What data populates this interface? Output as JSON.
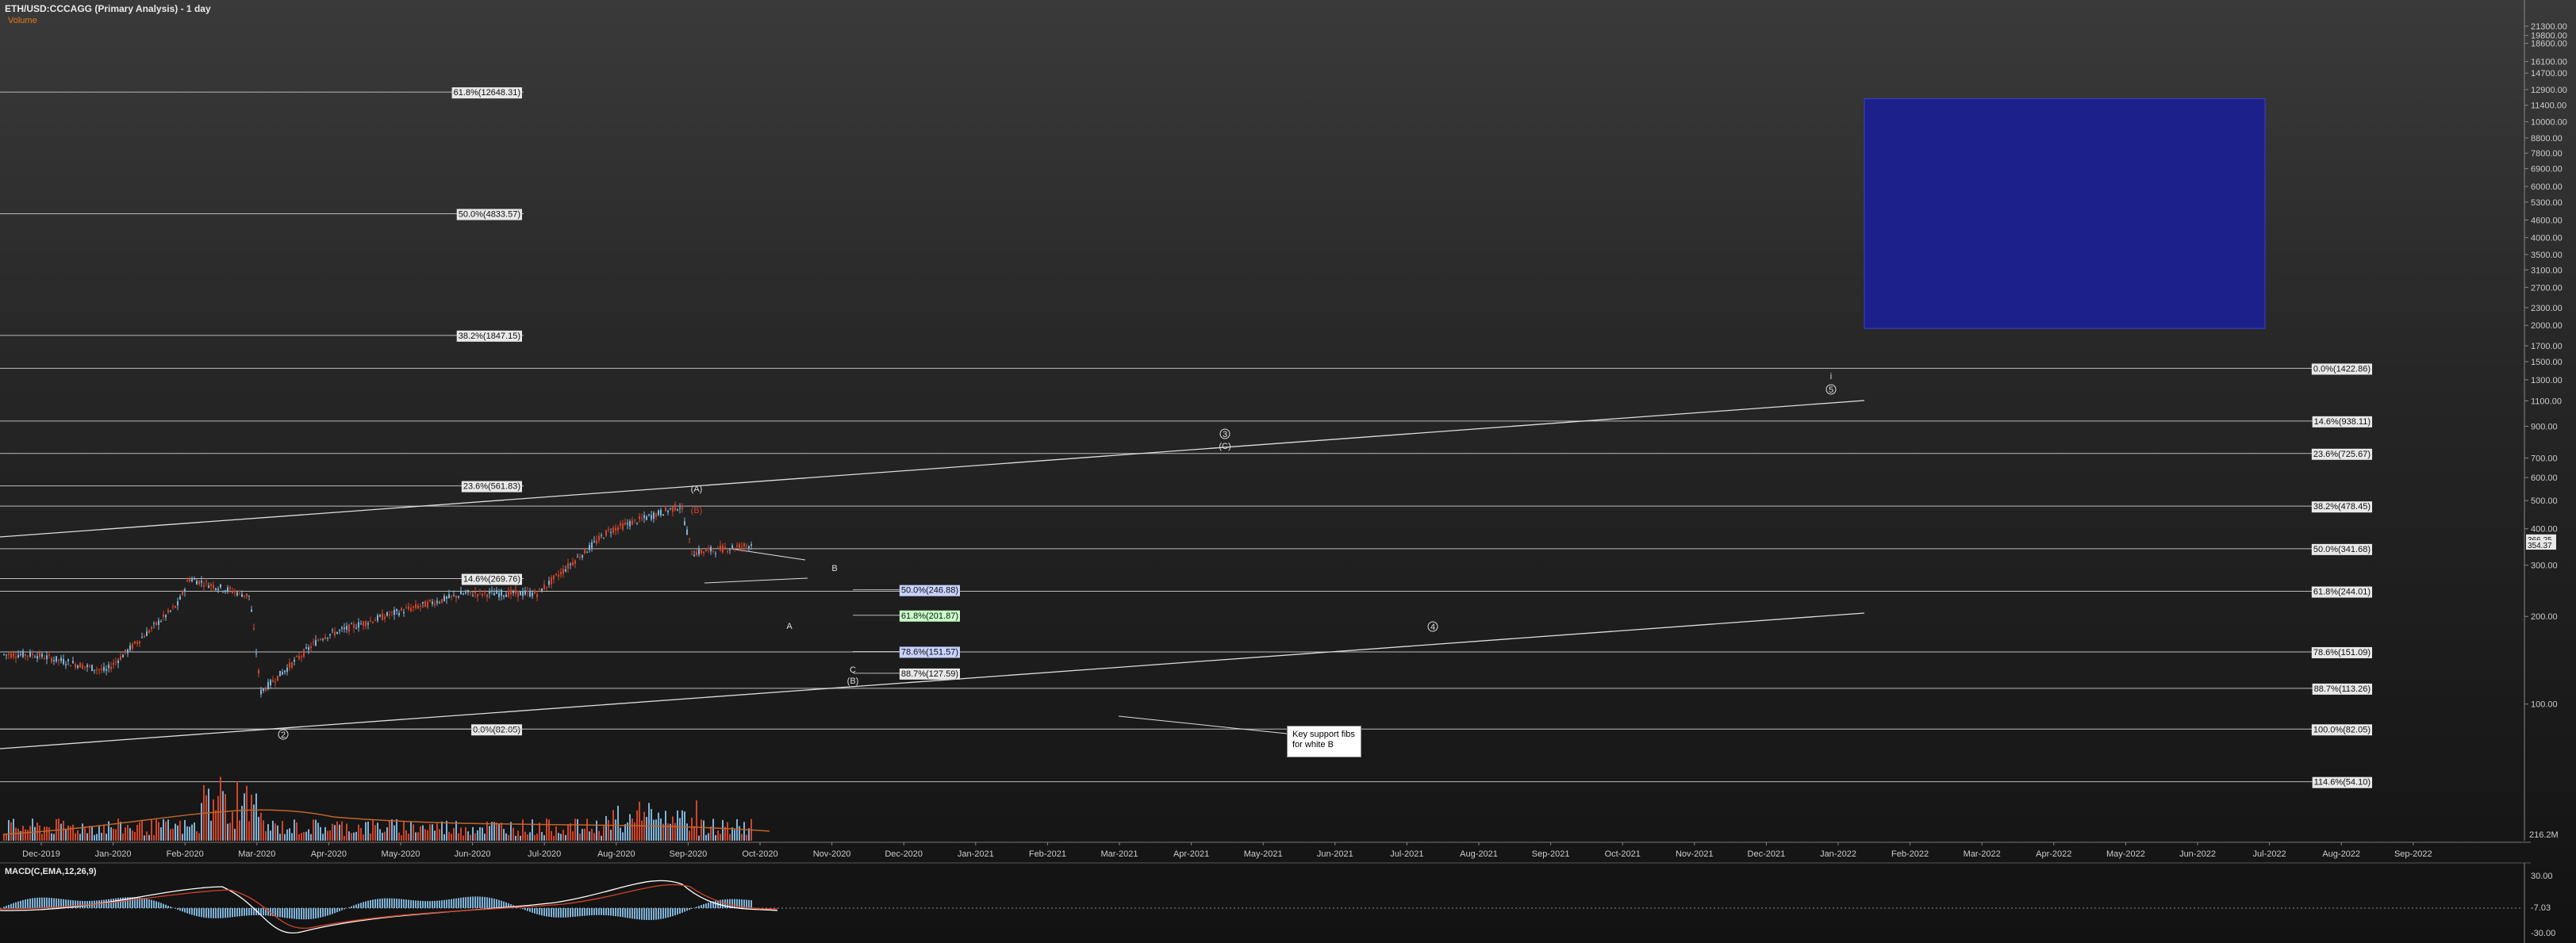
{
  "header": {
    "title": "ETH/USD:CCCAGG (Primary Analysis) - 1 day",
    "volume_label": "Volume"
  },
  "macd": {
    "label": "MACD(C,EMA,12,26,9)",
    "axis": [
      "30.00",
      "-7.03",
      "-30.00"
    ]
  },
  "volume_axis": {
    "label": "216.2M"
  },
  "annotation": {
    "lines": [
      "Key support fibs",
      "for white B"
    ]
  },
  "colors": {
    "up": "#7fb2d6",
    "down": "#d0442a",
    "line": "#d9d9d9",
    "target_box": "#1c208a",
    "volume_ma": "#c0652a"
  },
  "chart_data": {
    "type": "candlestick",
    "title": "ETH/USD:CCCAGG (Primary Analysis) - 1 day",
    "y_scale": "log",
    "y_ticks": [
      "21300.00",
      "19800.00",
      "18600.00",
      "16100.00",
      "14700.00",
      "12900.00",
      "11400.00",
      "10000.00",
      "8800.00",
      "7800.00",
      "6900.00",
      "6000.00",
      "5300.00",
      "4600.00",
      "4000.00",
      "3500.00",
      "3100.00",
      "2700.00",
      "2300.00",
      "2000.00",
      "1700.00",
      "1500.00",
      "1300.00",
      "1100.00",
      "900.00",
      "700.00",
      "600.00",
      "500.00",
      "400.00",
      "300.00",
      "200.00",
      "100.00"
    ],
    "x_ticks": [
      "Dec-2019",
      "Jan-2020",
      "Feb-2020",
      "Mar-2020",
      "Apr-2020",
      "May-2020",
      "Jun-2020",
      "Jul-2020",
      "Aug-2020",
      "Sep-2020",
      "Oct-2020",
      "Nov-2020",
      "Dec-2020",
      "Jan-2021",
      "Feb-2021",
      "Mar-2021",
      "Apr-2021",
      "May-2021",
      "Jun-2021",
      "Jul-2021",
      "Aug-2021",
      "Sep-2021",
      "Oct-2021",
      "Nov-2021",
      "Dec-2021",
      "Jan-2022",
      "Feb-2022",
      "Mar-2022",
      "Apr-2022",
      "May-2022",
      "Jun-2022",
      "Jul-2022",
      "Aug-2022",
      "Sep-2022"
    ],
    "price_labels": [
      "366.25",
      "354.37"
    ],
    "price_path": [
      [
        "Dec-2019",
        148
      ],
      [
        "Jan-2020",
        130
      ],
      [
        "Feb-2020",
        220
      ],
      [
        "Feb-2020",
        270
      ],
      [
        "Mar-2020",
        235
      ],
      [
        "Mar-2020",
        110
      ],
      [
        "Apr-2020",
        170
      ],
      [
        "May-2020",
        205
      ],
      [
        "Jun-2020",
        240
      ],
      [
        "Jul-2020",
        240
      ],
      [
        "Aug-2020",
        395
      ],
      [
        "Sep-2020",
        480
      ],
      [
        "Sep-2020",
        330
      ],
      [
        "Oct-2020",
        354
      ]
    ],
    "fib_right": [
      {
        "label": "0.0%(1422.86)",
        "value": 1422.86
      },
      {
        "label": "14.6%(938.11)",
        "value": 938.11
      },
      {
        "label": "23.6%(725.67)",
        "value": 725.67
      },
      {
        "label": "38.2%(478.45)",
        "value": 478.45
      },
      {
        "label": "50.0%(341.68)",
        "value": 341.68
      },
      {
        "label": "61.8%(244.01)",
        "value": 244.01
      },
      {
        "label": "78.6%(151.09)",
        "value": 151.09
      },
      {
        "label": "88.7%(113.26)",
        "value": 113.26
      },
      {
        "label": "100.0%(82.05)",
        "value": 82.05
      },
      {
        "label": "114.6%(54.10)",
        "value": 54.1
      }
    ],
    "fib_left": [
      {
        "label": "61.8%(12648.31)",
        "value": 12648.31
      },
      {
        "label": "50.0%(4833.57)",
        "value": 4833.57
      },
      {
        "label": "38.2%(1847.15)",
        "value": 1847.15
      },
      {
        "label": "23.6%(561.83)",
        "value": 561.83
      },
      {
        "label": "14.6%(269.76)",
        "value": 269.76
      },
      {
        "label": "0.0%(82.05)",
        "value": 82.05
      }
    ],
    "fib_mid": [
      {
        "label": "50.0%(246.88)",
        "value": 246.88,
        "style": "blue"
      },
      {
        "label": "61.8%(201.87)",
        "value": 201.87,
        "style": "green"
      },
      {
        "label": "78.6%(151.57)",
        "value": 151.57,
        "style": "blue"
      },
      {
        "label": "88.7%(127.59)",
        "value": 127.59,
        "style": "plain"
      }
    ],
    "wave_labels": [
      "(A)",
      "(B)",
      "B",
      "C",
      "(B)",
      "A",
      "i",
      "3",
      "(C)",
      "4",
      "5",
      "2"
    ],
    "target_box": {
      "from": "Jan-2022",
      "to": "Jun-2022",
      "low": 1950,
      "high": 12000
    }
  }
}
